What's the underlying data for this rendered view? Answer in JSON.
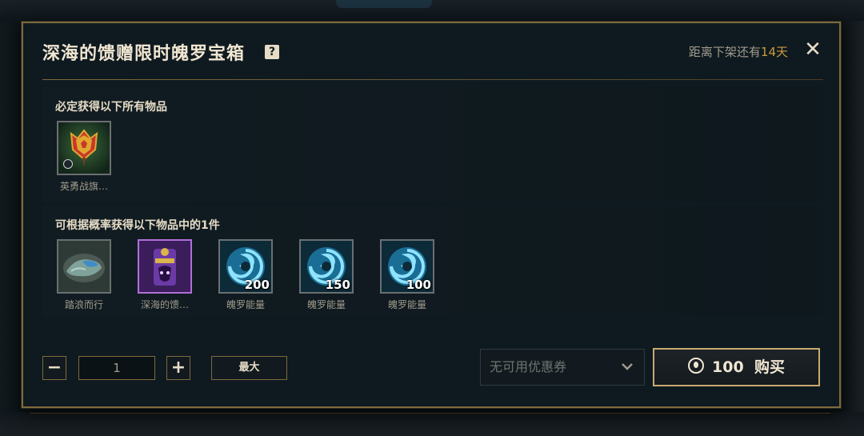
{
  "modal": {
    "title": "深海的馈赠限时魄罗宝箱",
    "help_icon": "?",
    "countdown_prefix": "距离下架还有",
    "countdown_days": "14天",
    "close_icon": "✕"
  },
  "guaranteed": {
    "title": "必定获得以下所有物品",
    "items": [
      {
        "label": "英勇战旗…",
        "icon": "banner-icon"
      }
    ]
  },
  "random": {
    "title": "可根据概率获得以下物品中的1件",
    "items": [
      {
        "label": "踏浪而行",
        "icon": "ward-skin-icon",
        "qty": ""
      },
      {
        "label": "深海的馈…",
        "icon": "emote-icon",
        "qty": ""
      },
      {
        "label": "魄罗能量",
        "icon": "poro-energy-icon",
        "qty": "200"
      },
      {
        "label": "魄罗能量",
        "icon": "poro-energy-icon",
        "qty": "150"
      },
      {
        "label": "魄罗能量",
        "icon": "poro-energy-icon",
        "qty": "100"
      }
    ]
  },
  "purchase": {
    "minus": "−",
    "quantity": "1",
    "plus": "+",
    "max_label": "最大",
    "coupon_text": "无可用优惠券",
    "price": "100",
    "buy_label": "购买"
  },
  "colors": {
    "gold": "#c89b3c",
    "border": "#7e6a3b",
    "epic": "#b070d8"
  }
}
